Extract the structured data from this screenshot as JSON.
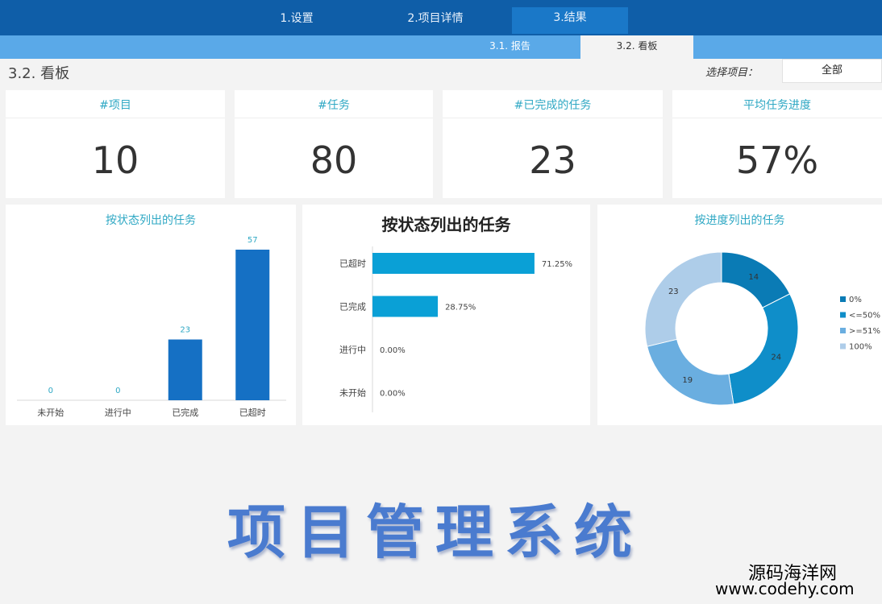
{
  "nav": {
    "tabs": [
      {
        "label": "1.设置"
      },
      {
        "label": "2.项目详情"
      },
      {
        "label": "3.结果"
      }
    ],
    "subtabs": [
      {
        "label": "3.1. 报告"
      },
      {
        "label": "3.2. 看板"
      }
    ]
  },
  "page": {
    "title": "3.2. 看板",
    "select_label": "选择项目：",
    "select_value": "全部"
  },
  "kpis": [
    {
      "label": "#项目",
      "value": "10"
    },
    {
      "label": "#任务",
      "value": "80"
    },
    {
      "label": "#已完成的任务",
      "value": "23"
    },
    {
      "label": "平均任务进度",
      "value": "57%"
    }
  ],
  "colors": {
    "bar": "#1570c4",
    "hbar": "#0aa0d6",
    "accent_text": "#2fa8c4",
    "donut": [
      "#0a7bb5",
      "#0f8ec9",
      "#6aaee0",
      "#aecde9"
    ]
  },
  "chart_data": [
    {
      "type": "bar",
      "title": "按状态列出的任务",
      "categories": [
        "未开始",
        "进行中",
        "已完成",
        "已超时"
      ],
      "values": [
        0,
        0,
        23,
        57
      ],
      "data_labels": [
        "0",
        "0",
        "23",
        "57"
      ],
      "ylim": [
        0,
        57
      ],
      "grid": false
    },
    {
      "type": "bar",
      "orientation": "horizontal",
      "title": "按状态列出的任务",
      "categories": [
        "已超时",
        "已完成",
        "进行中",
        "未开始"
      ],
      "values": [
        71.25,
        28.75,
        0,
        0
      ],
      "data_labels": [
        "71.25%",
        "28.75%",
        "0.00%",
        "0.00%"
      ],
      "xlim": [
        0,
        100
      ],
      "grid": false
    },
    {
      "type": "pie",
      "variant": "donut",
      "title": "按进度列出的任务",
      "categories": [
        "0%",
        "<=50%",
        ">=51%",
        "100%"
      ],
      "values": [
        14,
        24,
        19,
        23
      ],
      "data_labels": [
        "14",
        "24",
        "19",
        "23"
      ],
      "legend": "right"
    }
  ],
  "branding": {
    "title": "项目管理系统",
    "watermark_name": "源码海洋网",
    "watermark_url": "www.codehy.com"
  }
}
